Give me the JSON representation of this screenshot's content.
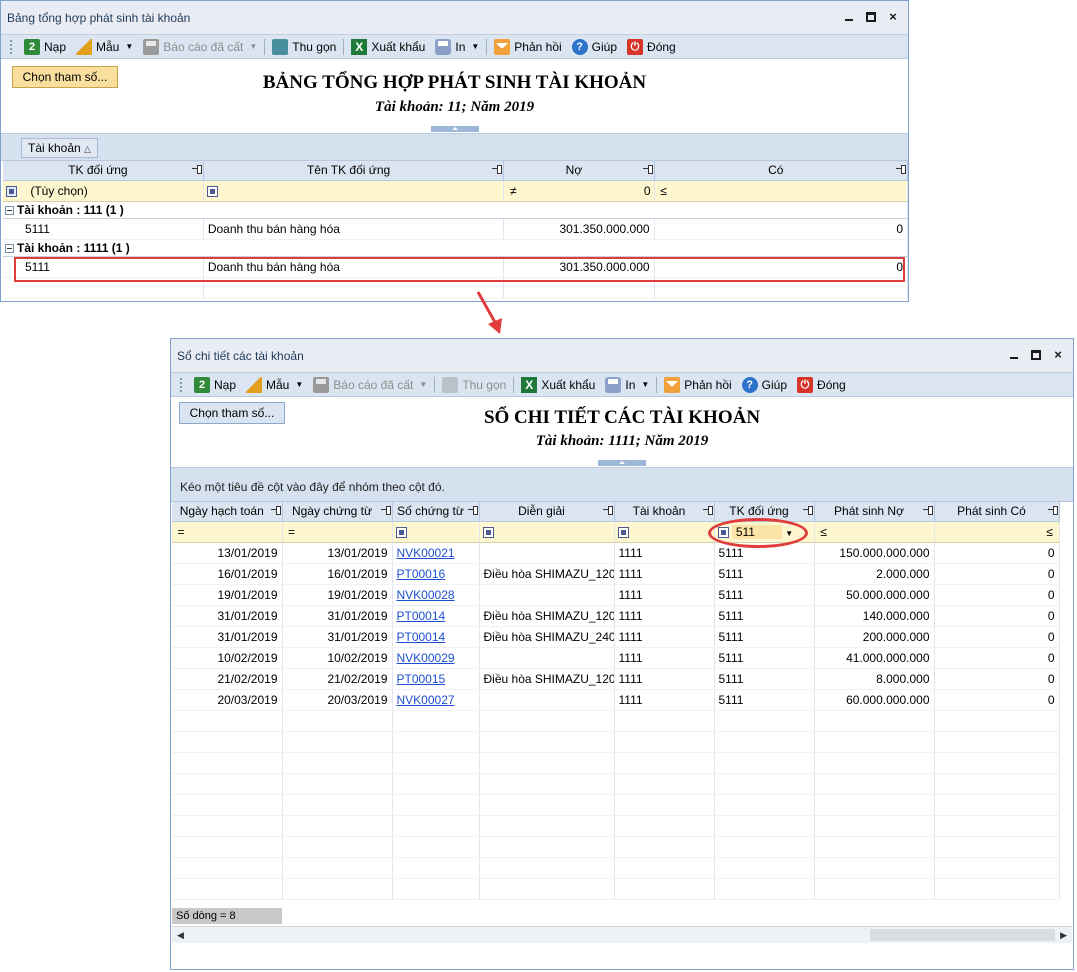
{
  "window1": {
    "title": "Bảng tổng hợp phát sinh tài khoản",
    "toolbar": {
      "nap": "Nạp",
      "mau": "Mẫu",
      "bao_cao_da_cat": "Báo cáo đã cất",
      "thu_gon": "Thu gọn",
      "xuat_khau": "Xuất khẩu",
      "in": "In",
      "phan_hoi": "Phản hồi",
      "giup": "Giúp",
      "dong": "Đóng"
    },
    "choose_params": "Chọn tham số...",
    "report_title": "BẢNG TỔNG HỢP PHÁT SINH TÀI KHOẢN",
    "report_subtitle": "Tài khoản: 11; Năm 2019",
    "group_chip": "Tài khoản",
    "columns": [
      "TK đối ứng",
      "Tên TK đối ứng",
      "Nợ",
      "Có"
    ],
    "filter": {
      "tk_placeholder": "(Tùy chọn)",
      "no_op": "≠",
      "no_value": "0",
      "co_op": "≤"
    },
    "groups": [
      {
        "label": "Tài khoản : 111 (1 )",
        "rows": [
          {
            "tk": "5111",
            "ten": "Doanh thu bán hàng hóa",
            "no": "301.350.000.000",
            "co": "0"
          }
        ]
      },
      {
        "label": "Tài khoản : 1111 (1 )",
        "rows": [
          {
            "tk": "5111",
            "ten": "Doanh thu bán hàng hóa",
            "no": "301.350.000.000",
            "co": "0"
          }
        ]
      }
    ]
  },
  "window2": {
    "title": "Sổ chi tiết các tài khoản",
    "toolbar": {
      "nap": "Nạp",
      "mau": "Mẫu",
      "bao_cao_da_cat": "Báo cáo đã cất",
      "thu_gon": "Thu gọn",
      "xuat_khau": "Xuất khẩu",
      "in": "In",
      "phan_hoi": "Phản hồi",
      "giup": "Giúp",
      "dong": "Đóng"
    },
    "choose_params": "Chọn tham số...",
    "report_title": "SỔ CHI TIẾT CÁC TÀI KHOẢN",
    "report_subtitle": "Tài khoản: 1111; Năm 2019",
    "group_hint": "Kéo một tiêu đề cột vào đây để nhóm theo cột đó.",
    "columns": [
      "Ngày hạch toán",
      "Ngày chứng từ",
      "Số chứng từ",
      "Diễn giải",
      "Tài khoản",
      "TK đối ứng",
      "Phát sinh Nợ",
      "Phát sinh Có"
    ],
    "filter": {
      "eq1": "=",
      "eq2": "=",
      "tk_doi_ung_value": "511",
      "no_op": "≤",
      "co_op": "≤"
    },
    "rows": [
      {
        "ngay_ht": "13/01/2019",
        "ngay_ct": "13/01/2019",
        "so_ct": "NVK00021",
        "dien_giai": "",
        "tk": "1111",
        "tk_du": "5111",
        "ps_no": "150.000.000.000",
        "ps_co": "0"
      },
      {
        "ngay_ht": "16/01/2019",
        "ngay_ct": "16/01/2019",
        "so_ct": "PT00016",
        "dien_giai": "Điều hòa SHIMAZU_120",
        "tk": "1111",
        "tk_du": "5111",
        "ps_no": "2.000.000",
        "ps_co": "0"
      },
      {
        "ngay_ht": "19/01/2019",
        "ngay_ct": "19/01/2019",
        "so_ct": "NVK00028",
        "dien_giai": "",
        "tk": "1111",
        "tk_du": "5111",
        "ps_no": "50.000.000.000",
        "ps_co": "0"
      },
      {
        "ngay_ht": "31/01/2019",
        "ngay_ct": "31/01/2019",
        "so_ct": "PT00014",
        "dien_giai": "Điều hòa SHIMAZU_120",
        "tk": "1111",
        "tk_du": "5111",
        "ps_no": "140.000.000",
        "ps_co": "0"
      },
      {
        "ngay_ht": "31/01/2019",
        "ngay_ct": "31/01/2019",
        "so_ct": "PT00014",
        "dien_giai": "Điều hòa SHIMAZU_240",
        "tk": "1111",
        "tk_du": "5111",
        "ps_no": "200.000.000",
        "ps_co": "0"
      },
      {
        "ngay_ht": "10/02/2019",
        "ngay_ct": "10/02/2019",
        "so_ct": "NVK00029",
        "dien_giai": "",
        "tk": "1111",
        "tk_du": "5111",
        "ps_no": "41.000.000.000",
        "ps_co": "0"
      },
      {
        "ngay_ht": "21/02/2019",
        "ngay_ct": "21/02/2019",
        "so_ct": "PT00015",
        "dien_giai": "Điều hòa SHIMAZU_120",
        "tk": "1111",
        "tk_du": "5111",
        "ps_no": "8.000.000",
        "ps_co": "0"
      },
      {
        "ngay_ht": "20/03/2019",
        "ngay_ct": "20/03/2019",
        "so_ct": "NVK00027",
        "dien_giai": "",
        "tk": "1111",
        "tk_du": "5111",
        "ps_no": "60.000.000.000",
        "ps_co": "0"
      }
    ],
    "status": "Số dòng = 8"
  },
  "colors": {
    "highlight": "#e03c3c",
    "link": "#1d4fd1",
    "filter_bg": "#fdf6cf",
    "toolbar_bg": "#dbe5f1"
  }
}
